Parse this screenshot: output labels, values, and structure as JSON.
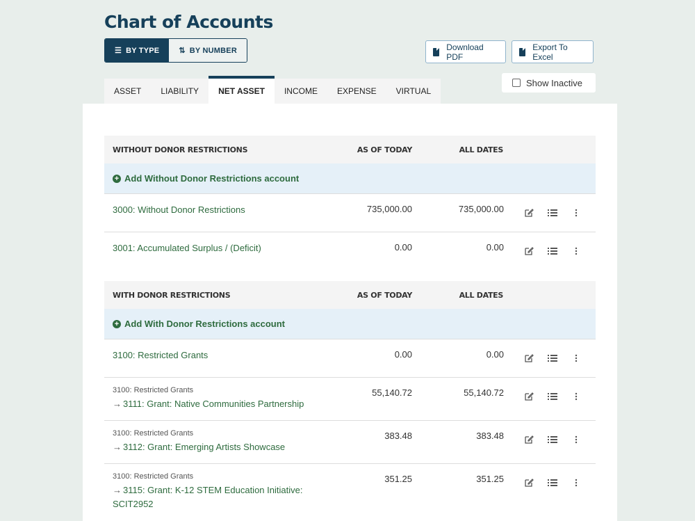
{
  "page": {
    "title": "Chart of Accounts"
  },
  "view_toggle": {
    "by_type": "BY TYPE",
    "by_number": "BY NUMBER",
    "active": "by_type"
  },
  "toolbar": {
    "download_pdf": "Download PDF",
    "export_excel": "Export To Excel",
    "show_inactive": "Show Inactive",
    "show_inactive_checked": false
  },
  "tabs": [
    {
      "label": "ASSET",
      "active": false
    },
    {
      "label": "LIABILITY",
      "active": false
    },
    {
      "label": "NET ASSET",
      "active": true
    },
    {
      "label": "INCOME",
      "active": false
    },
    {
      "label": "EXPENSE",
      "active": false
    },
    {
      "label": "VIRTUAL",
      "active": false
    }
  ],
  "colors": {
    "brand": "#16405a",
    "account_link": "#2e6b3e",
    "add_row_bg": "#e5f0f8"
  },
  "sections": [
    {
      "header": "WITHOUT DONOR RESTRICTIONS",
      "col_today": "AS OF TODAY",
      "col_all": "ALL DATES",
      "add_label": "Add Without Donor Restrictions account",
      "rows": [
        {
          "parent": "",
          "account": "3000: Without Donor Restrictions",
          "as_of_today": "735,000.00",
          "all_dates": "735,000.00"
        },
        {
          "parent": "",
          "account": "3001: Accumulated Surplus / (Deficit)",
          "as_of_today": "0.00",
          "all_dates": "0.00"
        }
      ]
    },
    {
      "header": "WITH DONOR RESTRICTIONS",
      "col_today": "AS OF TODAY",
      "col_all": "ALL DATES",
      "add_label": "Add With Donor Restrictions account",
      "rows": [
        {
          "parent": "",
          "account": "3100: Restricted Grants",
          "as_of_today": "0.00",
          "all_dates": "0.00"
        },
        {
          "parent": "3100: Restricted Grants",
          "account": "3111: Grant: Native Communities Partnership",
          "as_of_today": "55,140.72",
          "all_dates": "55,140.72"
        },
        {
          "parent": "3100: Restricted Grants",
          "account": "3112: Grant: Emerging Artists Showcase",
          "as_of_today": "383.48",
          "all_dates": "383.48"
        },
        {
          "parent": "3100: Restricted Grants",
          "account": "3115: Grant: K-12 STEM Education Initiative: SCIT2952",
          "as_of_today": "351.25",
          "all_dates": "351.25"
        }
      ]
    }
  ],
  "icons": {
    "edit": "edit-icon",
    "ledger": "list-icon",
    "more": "more-vertical-icon",
    "child_arrow": "→"
  }
}
